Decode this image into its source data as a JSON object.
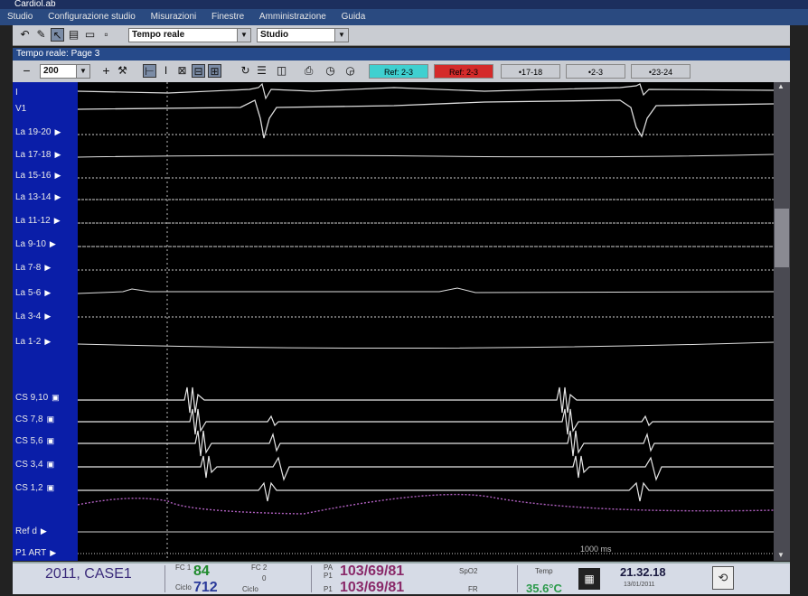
{
  "window": {
    "title": "Cardiol.ab"
  },
  "menu": [
    "Studio",
    "Configurazione studio",
    "Misurazioni",
    "Finestre",
    "Amministrazione",
    "Guida"
  ],
  "toolbar": {
    "mode_select": "Tempo reale",
    "view_select": "Studio"
  },
  "panel": {
    "title": "Tempo reale: Page 3"
  },
  "controls": {
    "minus": "−",
    "speed": "200",
    "plus": "+",
    "buttons": [
      {
        "label": "Ref: 2-3",
        "color": "#3fd0d0"
      },
      {
        "label": "Ref: 2-3",
        "color": "#d42a2a"
      },
      {
        "label": "•17-18",
        "color": "#c9ccd2"
      },
      {
        "label": "•2-3",
        "color": "#c9ccd2"
      },
      {
        "label": "•23-24",
        "color": "#c9ccd2"
      }
    ]
  },
  "channels": [
    "I",
    "V1",
    "La 19-20",
    "La 17-18",
    "La 15-16",
    "La 13-14",
    "La 11-12",
    "La 9-10",
    "La 7-8",
    "La 5-6",
    "La 3-4",
    "La 1-2",
    "CS 9,10",
    "CS 7,8",
    "CS 5,6",
    "CS 3,4",
    "CS 1,2",
    "Ref d",
    "P1 ART"
  ],
  "scale_label": "1000 ms",
  "status": {
    "patient": "2011, CASE1",
    "hr_label": "FC 1",
    "hr_value": "84",
    "fc2_label": "FC 2",
    "fc2_value": "0",
    "cycle_label": "Ciclo",
    "cycle_value": "712",
    "cycle2_label": "Ciclo",
    "pa_label": "PA",
    "p1_label": "P1",
    "pressure1": "103/69/81",
    "p1b_label": "P1",
    "pressure2": "103/69/81",
    "spo2_label": "SpO2",
    "fr_label": "FR",
    "temp_label": "Temp",
    "temp_value": "35.6°C",
    "clock": "21.32.18",
    "date": "13/01/2011"
  },
  "colors": {
    "accent": "#2a4a80",
    "label_panel": "#0a1ea8",
    "hr": "#1f8a2c",
    "pressure": "#8a2a6a",
    "temp": "#2a9a4a"
  }
}
